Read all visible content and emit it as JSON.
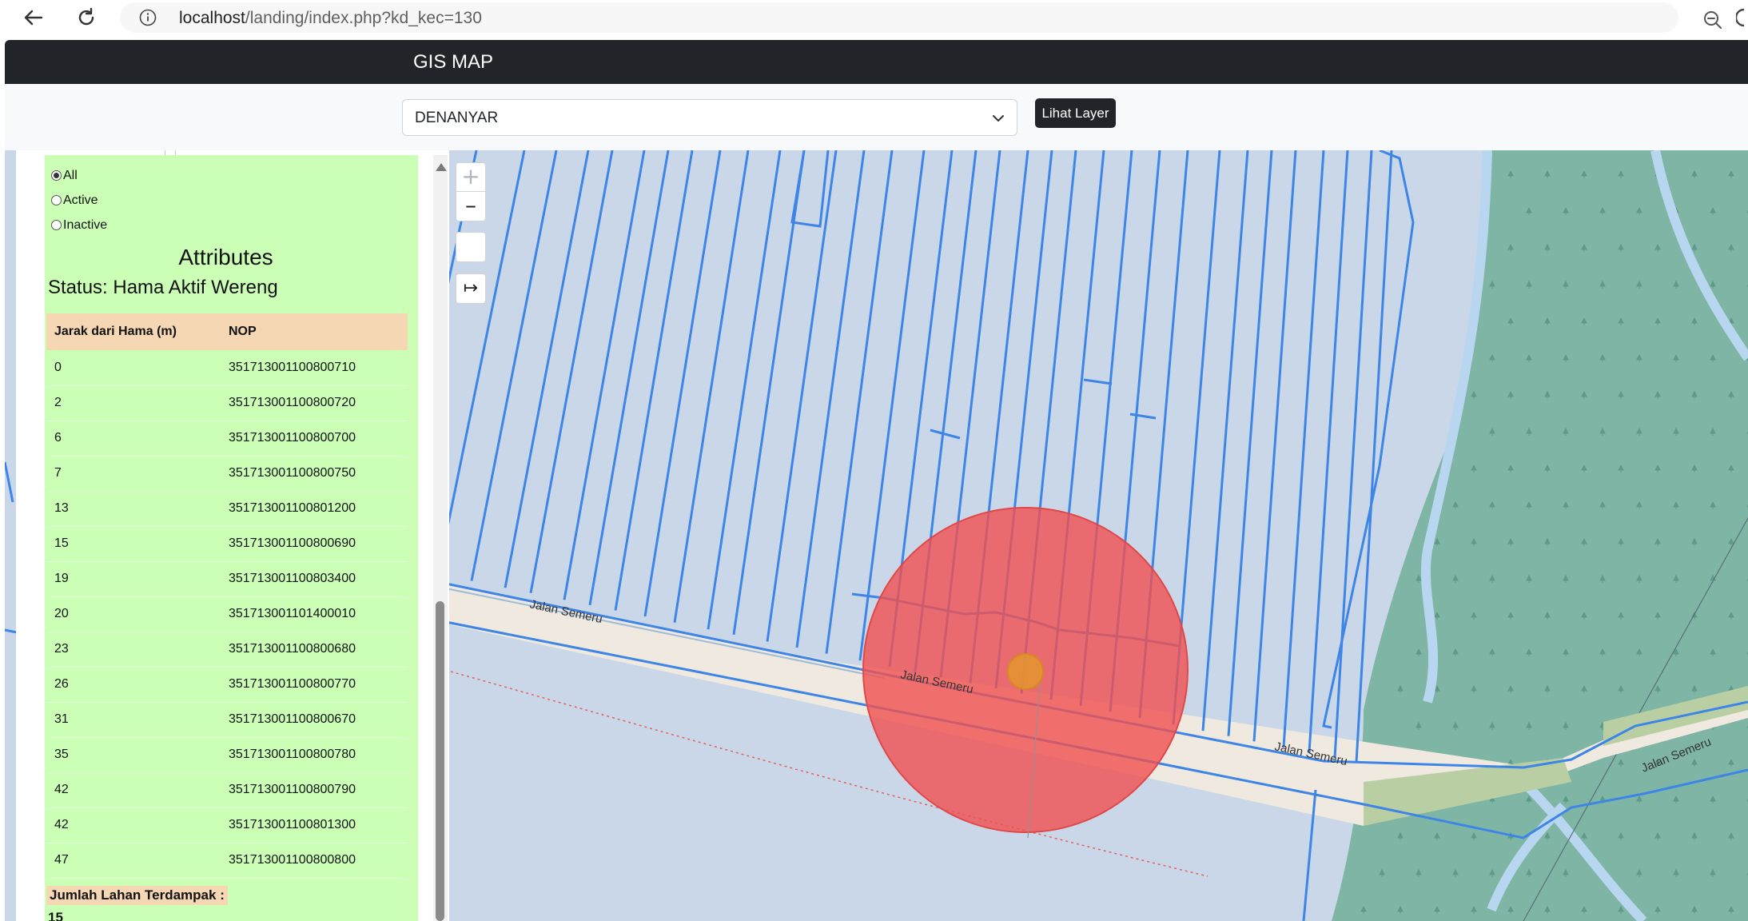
{
  "browser": {
    "url_host": "localhost",
    "url_path": "/landing/index.php?kd_kec=130",
    "icons": [
      "back-icon",
      "reload-icon",
      "site-info-icon",
      "zoom-out-icon",
      "read-aloud-icon",
      "favorite-star-icon"
    ]
  },
  "navbar": {
    "brand": "GIS MAP"
  },
  "filter": {
    "selected_kecamatan": "DENANYAR",
    "layer_button": "Lihat Layer"
  },
  "map": {
    "zoom_in": "+",
    "zoom_out": "–",
    "extent_symbol": "↦",
    "road_labels": [
      "Jalan Semeru",
      "Jalan Semeru",
      "Jalan Semeru",
      "Jalan Semeru"
    ],
    "colors": {
      "parcel_line": "#3d85e6",
      "buffer_fill": "#f05050",
      "point_fill": "#e39a2a",
      "forest": "#7fb5a5",
      "road": "#f2efe9"
    }
  },
  "panel": {
    "radio_options": [
      "All",
      "Active",
      "Inactive"
    ],
    "radio_selected": "All",
    "attributes_title": "Attributes",
    "status": "Status: Hama Aktif Wereng",
    "table": {
      "headers": [
        "Jarak dari Hama (m)",
        "NOP"
      ],
      "rows": [
        [
          "0",
          "351713001100800710"
        ],
        [
          "2",
          "351713001100800720"
        ],
        [
          "6",
          "351713001100800700"
        ],
        [
          "7",
          "351713001100800750"
        ],
        [
          "13",
          "351713001100801200"
        ],
        [
          "15",
          "351713001100800690"
        ],
        [
          "19",
          "351713001100803400"
        ],
        [
          "20",
          "351713001101400010"
        ],
        [
          "23",
          "351713001100800680"
        ],
        [
          "26",
          "351713001100800770"
        ],
        [
          "31",
          "351713001100800670"
        ],
        [
          "35",
          "351713001100800780"
        ],
        [
          "42",
          "351713001100800790"
        ],
        [
          "42",
          "351713001100801300"
        ],
        [
          "47",
          "351713001100800800"
        ]
      ]
    },
    "total_label": "Jumlah Lahan Terdampak :",
    "total_value": "15"
  }
}
